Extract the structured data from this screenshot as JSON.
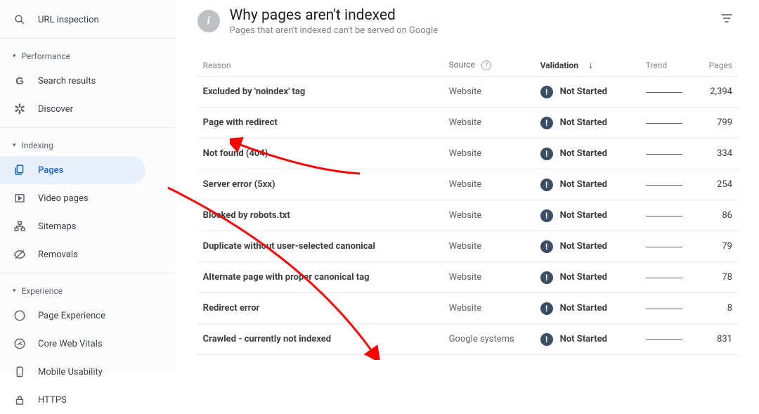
{
  "sidebar": {
    "urlInspection": "URL inspection",
    "sections": [
      {
        "label": "Performance",
        "items": [
          {
            "label": "Search results",
            "icon": "g-icon"
          },
          {
            "label": "Discover",
            "icon": "asterisk-icon"
          }
        ]
      },
      {
        "label": "Indexing",
        "items": [
          {
            "label": "Pages",
            "icon": "pages-icon",
            "active": true
          },
          {
            "label": "Video pages",
            "icon": "video-pages-icon"
          },
          {
            "label": "Sitemaps",
            "icon": "sitemaps-icon"
          },
          {
            "label": "Removals",
            "icon": "removals-icon"
          }
        ]
      },
      {
        "label": "Experience",
        "items": [
          {
            "label": "Page Experience",
            "icon": "page-exp-icon"
          },
          {
            "label": "Core Web Vitals",
            "icon": "cwv-icon"
          },
          {
            "label": "Mobile Usability",
            "icon": "mobile-icon"
          },
          {
            "label": "HTTPS",
            "icon": "https-icon"
          }
        ]
      }
    ]
  },
  "header": {
    "title": "Why pages aren't indexed",
    "subtitle": "Pages that aren't indexed can't be served on Google"
  },
  "columns": {
    "reason": "Reason",
    "source": "Source",
    "validation": "Validation",
    "trend": "Trend",
    "pages": "Pages"
  },
  "rows": [
    {
      "reason": "Excluded by 'noindex' tag",
      "source": "Website",
      "validation": "Not Started",
      "pages": "2,394"
    },
    {
      "reason": "Page with redirect",
      "source": "Website",
      "validation": "Not Started",
      "pages": "799"
    },
    {
      "reason": "Not found (404)",
      "source": "Website",
      "validation": "Not Started",
      "pages": "334"
    },
    {
      "reason": "Server error (5xx)",
      "source": "Website",
      "validation": "Not Started",
      "pages": "254"
    },
    {
      "reason": "Blocked by robots.txt",
      "source": "Website",
      "validation": "Not Started",
      "pages": "86"
    },
    {
      "reason": "Duplicate without user-selected canonical",
      "source": "Website",
      "validation": "Not Started",
      "pages": "79"
    },
    {
      "reason": "Alternate page with proper canonical tag",
      "source": "Website",
      "validation": "Not Started",
      "pages": "78"
    },
    {
      "reason": "Redirect error",
      "source": "Website",
      "validation": "Not Started",
      "pages": "8"
    },
    {
      "reason": "Crawled - currently not indexed",
      "source": "Google systems",
      "validation": "Not Started",
      "pages": "831"
    }
  ]
}
